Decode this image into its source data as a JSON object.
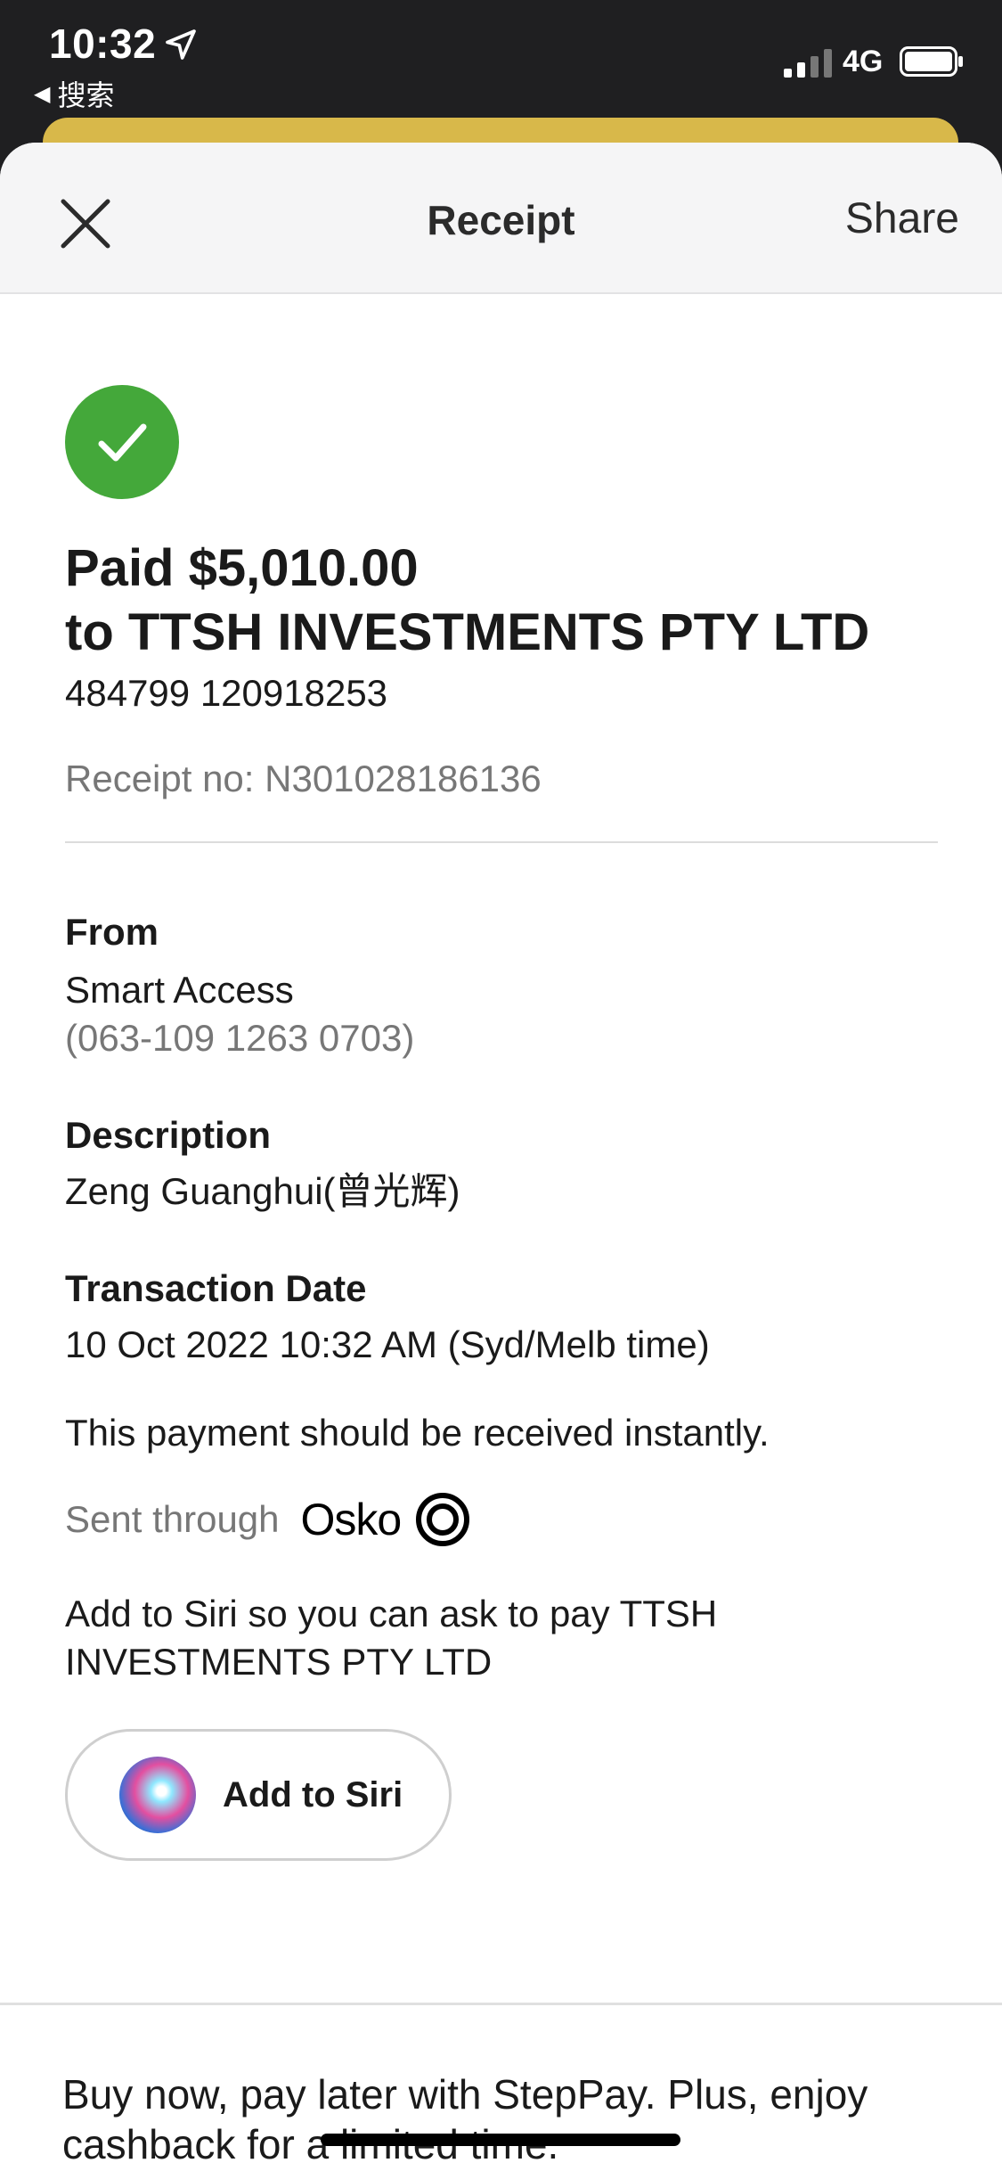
{
  "status_bar": {
    "time": "10:32",
    "back_app": "搜索",
    "network": "4G",
    "icons": [
      "location-arrow-icon",
      "signal-icon",
      "battery-icon"
    ]
  },
  "nav": {
    "title": "Receipt",
    "share_label": "Share",
    "close_icon": "close-icon"
  },
  "receipt": {
    "headline_amount": "Paid $5,010.00",
    "headline_payee": "to TTSH INVESTMENTS PTY LTD",
    "payee_account": "484799 120918253",
    "receipt_no": "Receipt no: N301028186136"
  },
  "from": {
    "label": "From",
    "account_name": "Smart Access",
    "account_number": "(063-109 1263 0703)"
  },
  "description": {
    "label": "Description",
    "value": "Zeng Guanghui(曾光辉)"
  },
  "transaction_date": {
    "label": "Transaction Date",
    "value": "10 Oct 2022 10:32 AM (Syd/Melb time)"
  },
  "instant_note": "This payment should be received instantly.",
  "sent_through": {
    "label": "Sent through",
    "brand": "Osko"
  },
  "siri": {
    "prompt": "Add to Siri so you can ask to pay TTSH INVESTMENTS PTY LTD",
    "button_label": "Add to Siri"
  },
  "promo": {
    "text": "Buy now, pay later with StepPay. Plus, enjoy cashback for a limited time."
  },
  "colors": {
    "success_green": "#44a83a",
    "gold": "#d8b84a",
    "dark_status": "#1f1f21"
  }
}
